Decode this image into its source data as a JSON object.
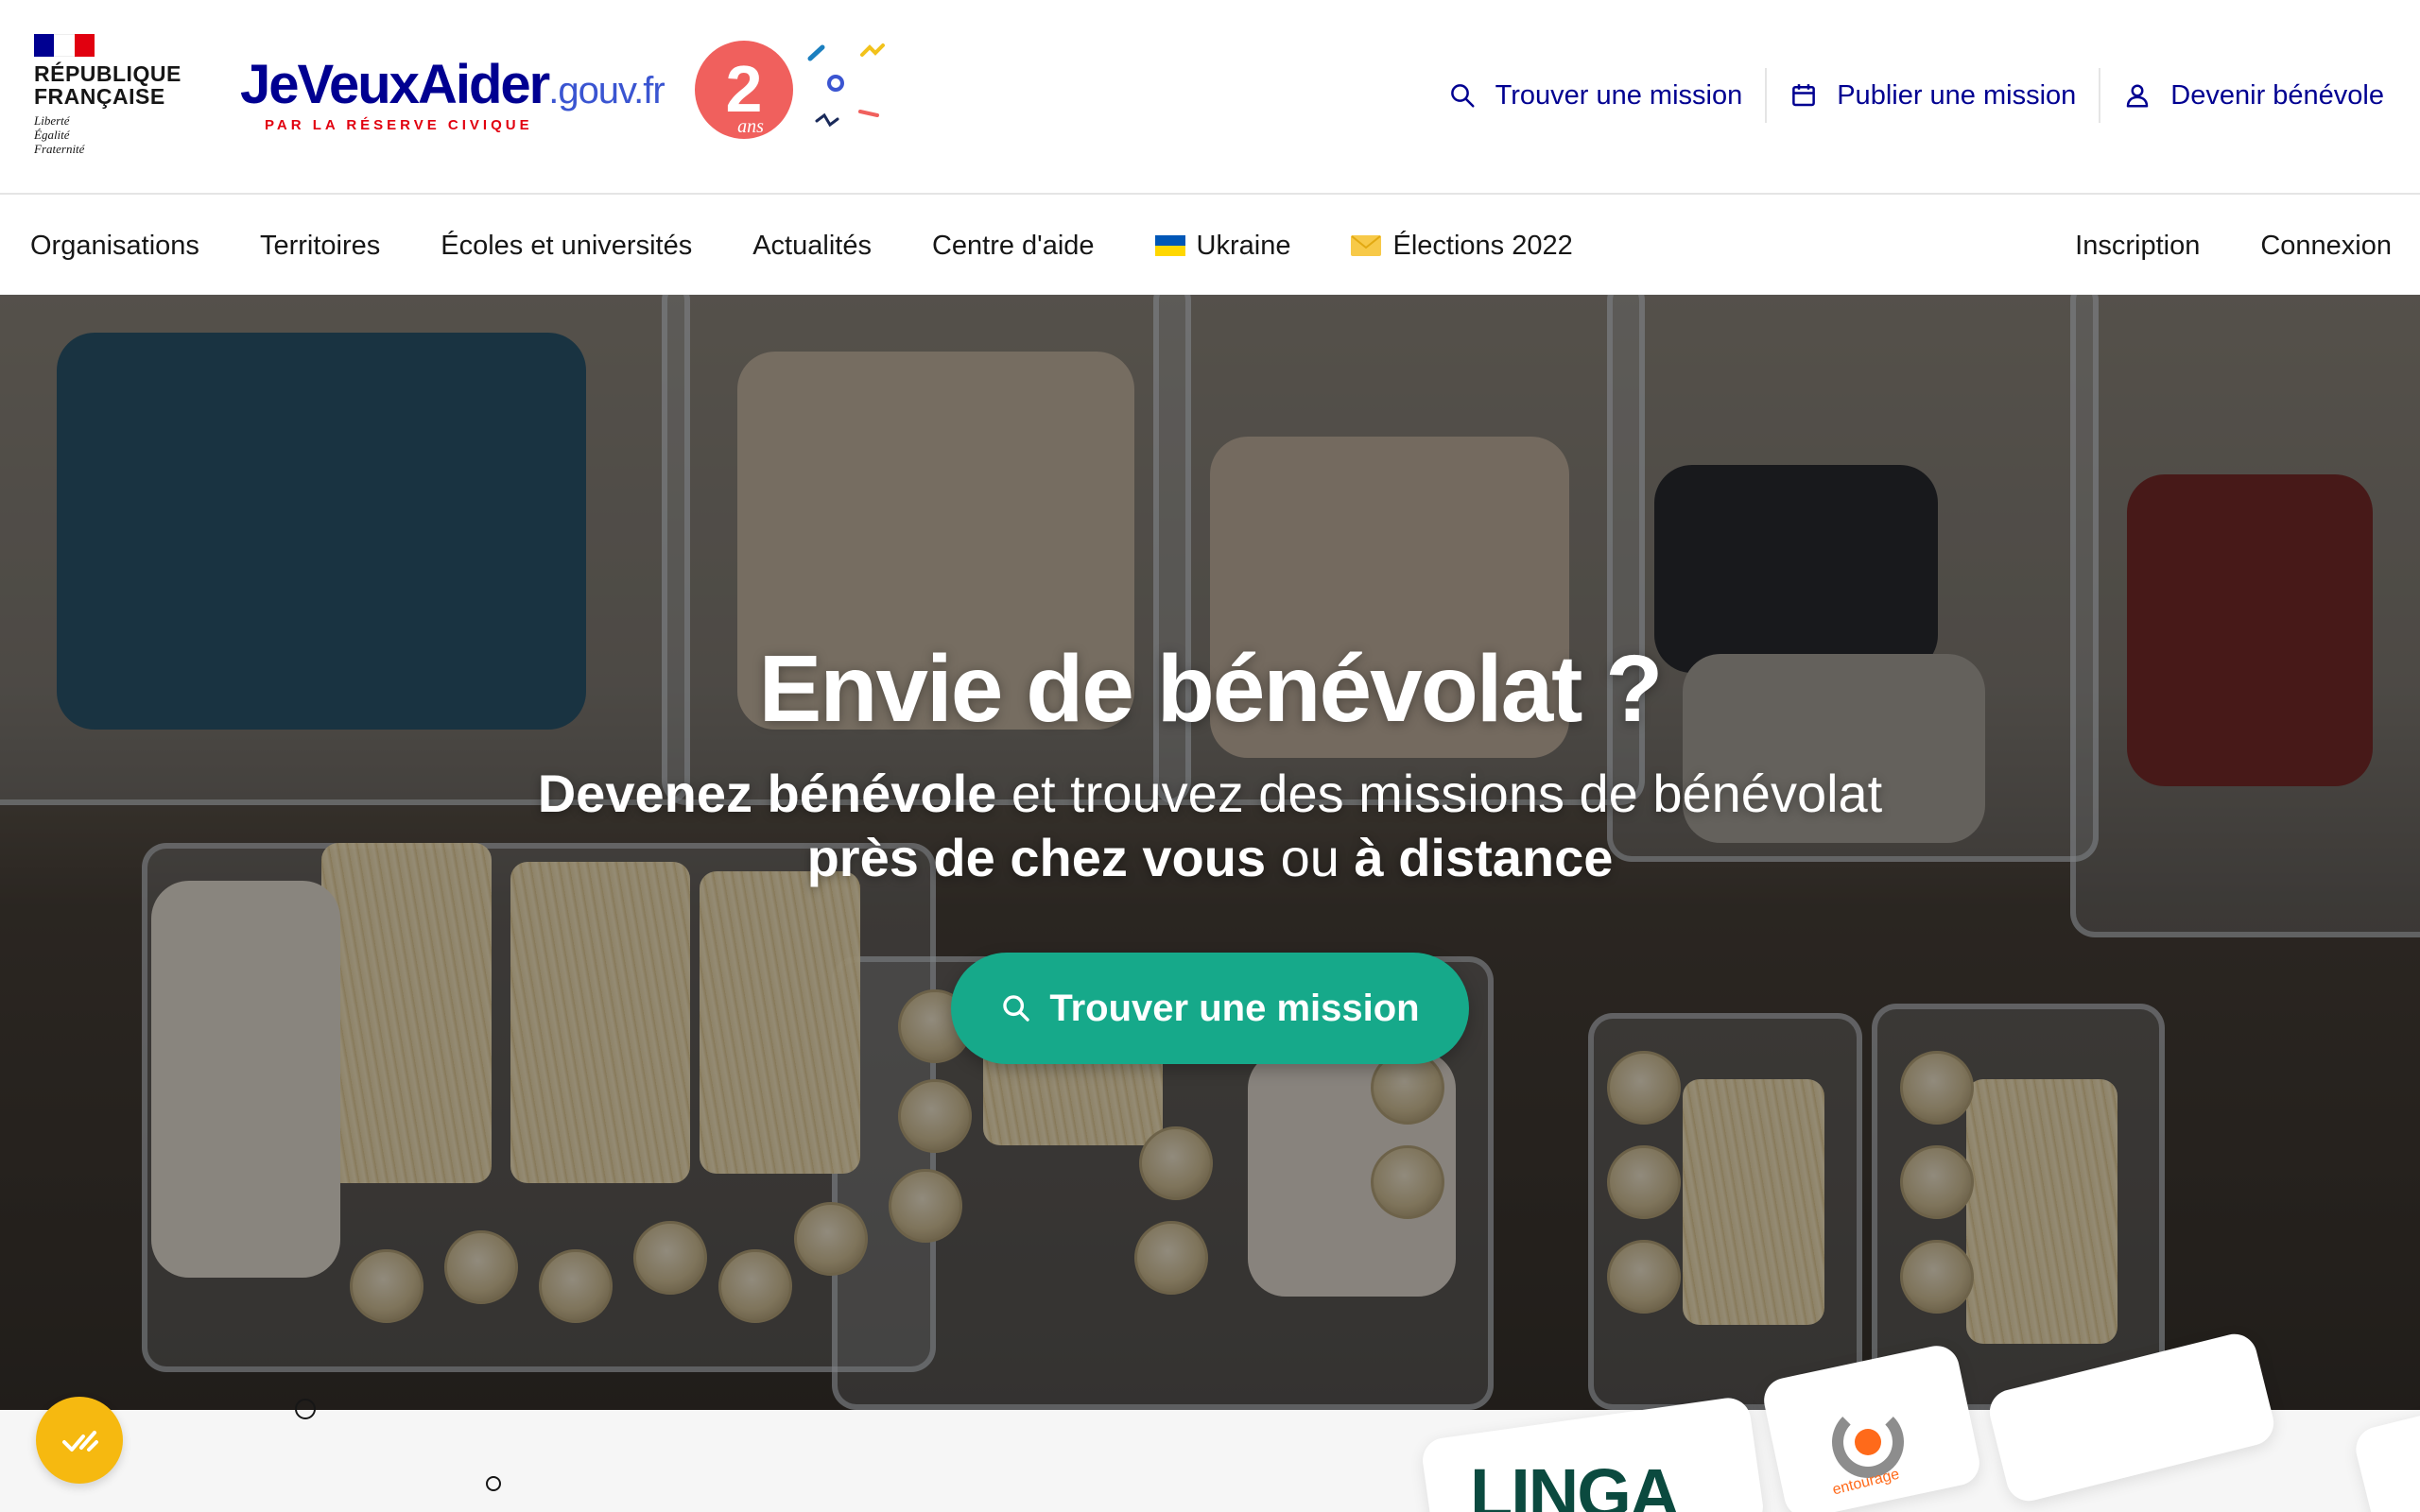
{
  "header": {
    "gov_block": {
      "republic_line1": "RÉPUBLIQUE",
      "republic_line2": "FRANÇAISE",
      "motto": [
        "Liberté",
        "Égalité",
        "Fraternité"
      ],
      "flag_colors": [
        "#000091",
        "#ffffff",
        "#e1000f"
      ]
    },
    "brand": {
      "name": "JeVeuxAider",
      "suffix": ".gouv.fr",
      "tagline": "PAR LA RÉSERVE CIVIQUE"
    },
    "anniversary": {
      "number": "2",
      "word": "ans"
    },
    "quick_links": [
      {
        "label": "Trouver une mission",
        "icon": "search-icon"
      },
      {
        "label": "Publier une mission",
        "icon": "calendar-icon"
      },
      {
        "label": "Devenir bénévole",
        "icon": "user-icon"
      }
    ]
  },
  "nav": {
    "items": [
      {
        "label": "Organisations"
      },
      {
        "label": "Territoires"
      },
      {
        "label": "Écoles et universités"
      },
      {
        "label": "Actualités"
      },
      {
        "label": "Centre d'aide"
      },
      {
        "label": "Ukraine",
        "icon": "ukraine-flag-icon"
      },
      {
        "label": "Élections 2022",
        "icon": "envelope-icon"
      }
    ],
    "auth": {
      "signup": "Inscription",
      "login": "Connexion"
    }
  },
  "hero": {
    "title": "Envie de bénévolat ?",
    "subtitle": {
      "part1_bold": "Devenez bénévole",
      "part2": " et trouvez des missions de bénévolat",
      "part3_bold": "près de chez vous",
      "part4": " ou ",
      "part5_bold": "à distance"
    },
    "cta_label": "Trouver une mission"
  },
  "partners": {
    "logo1": "LINGA",
    "logo2": "entourage"
  },
  "colors": {
    "brand_blue": "#000091",
    "marianne_red": "#e1000f",
    "cta_green": "#16a98a",
    "accessibility_yellow": "#f6b910"
  }
}
